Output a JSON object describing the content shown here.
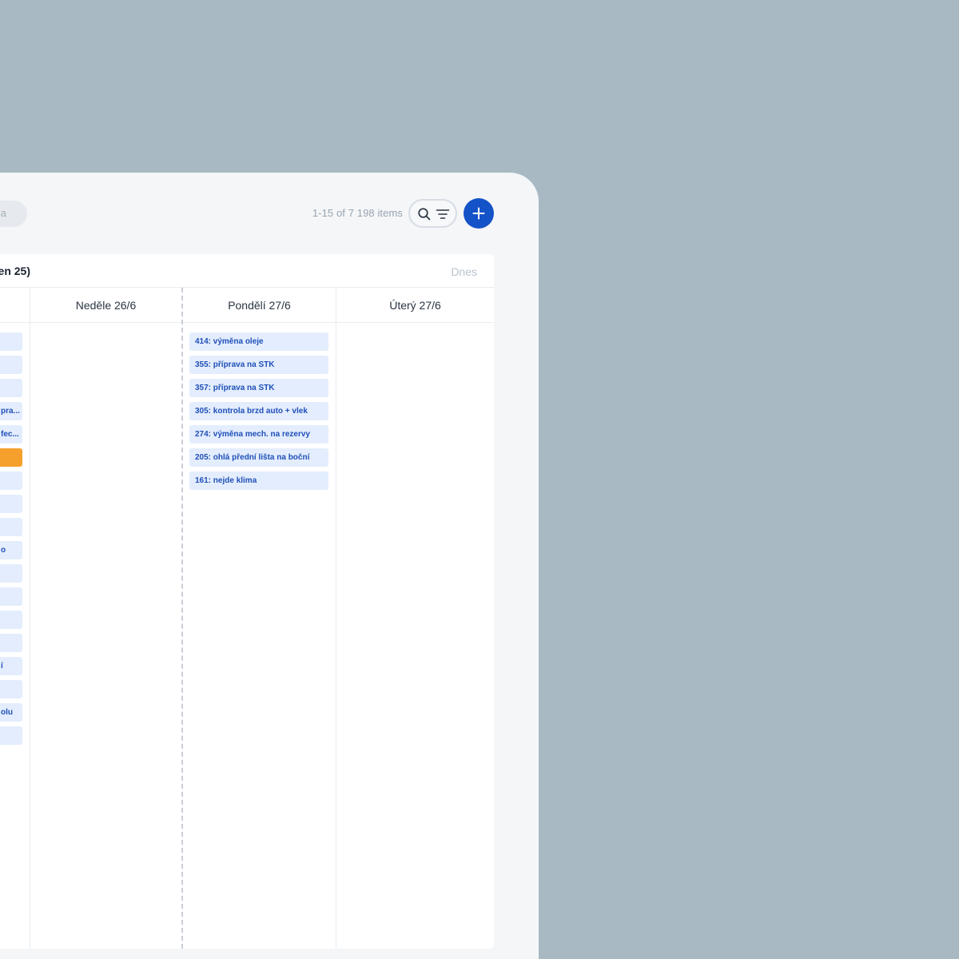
{
  "search": {
    "placeholder_tail": "a"
  },
  "toolbar": {
    "item_count": "1-15 of 7 198 items"
  },
  "board": {
    "title": "en 25)",
    "today": "Dnes",
    "columns": [
      {
        "label": "Neděle 26/6"
      },
      {
        "label": "Pondělí 27/6"
      },
      {
        "label": "Úterý 27/6"
      }
    ],
    "left_column_fragments": [
      "",
      "",
      "",
      "pra...",
      "fec...",
      "",
      "",
      "",
      "",
      "o",
      "",
      "",
      "",
      "",
      "í",
      "",
      "olu",
      ""
    ],
    "monday_cards": [
      "414: výměna oleje",
      "355: příprava na STK",
      "357: příprava na STK",
      "305: kontrola brzd auto + vlek",
      "274: výměna mech. na rezervy",
      "205: ohlá přední lišta na boční",
      "161: nejde klima"
    ]
  },
  "colors": {
    "background": "#a9b9c3",
    "accent": "#1452c8",
    "card": "#e3edfd",
    "card_text": "#1f4fb8",
    "highlight": "#f5a02c"
  }
}
